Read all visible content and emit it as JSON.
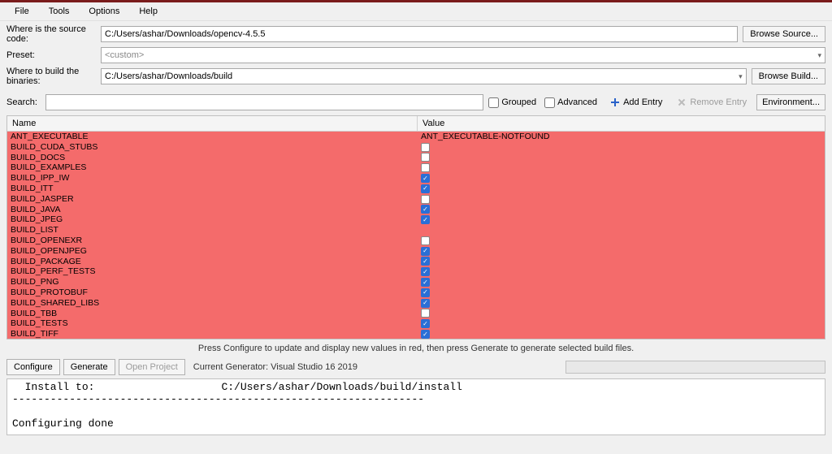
{
  "menu": {
    "file": "File",
    "tools": "Tools",
    "options": "Options",
    "help": "Help"
  },
  "labels": {
    "source": "Where is the source code:",
    "preset": "Preset:",
    "build": "Where to build the binaries:",
    "search": "Search:",
    "grouped": "Grouped",
    "advanced": "Advanced",
    "add_entry": "Add Entry",
    "remove_entry": "Remove Entry",
    "environment": "Environment...",
    "browse_source": "Browse Source...",
    "browse_build": "Browse Build...",
    "configure": "Configure",
    "generate": "Generate",
    "open_project": "Open Project",
    "current_generator": "Current Generator: Visual Studio 16 2019",
    "hint": "Press Configure to update and display new values in red, then press Generate to generate selected build files."
  },
  "fields": {
    "source_path": "C:/Users/ashar/Downloads/opencv-4.5.5",
    "preset_value": "<custom>",
    "build_path": "C:/Users/ashar/Downloads/build",
    "search_value": ""
  },
  "columns": {
    "name": "Name",
    "value": "Value"
  },
  "entries": [
    {
      "name": "ANT_EXECUTABLE",
      "type": "text",
      "value": "ANT_EXECUTABLE-NOTFOUND"
    },
    {
      "name": "BUILD_CUDA_STUBS",
      "type": "bool",
      "value": false
    },
    {
      "name": "BUILD_DOCS",
      "type": "bool",
      "value": false
    },
    {
      "name": "BUILD_EXAMPLES",
      "type": "bool",
      "value": false
    },
    {
      "name": "BUILD_IPP_IW",
      "type": "bool",
      "value": true
    },
    {
      "name": "BUILD_ITT",
      "type": "bool",
      "value": true
    },
    {
      "name": "BUILD_JASPER",
      "type": "bool",
      "value": false
    },
    {
      "name": "BUILD_JAVA",
      "type": "bool",
      "value": true
    },
    {
      "name": "BUILD_JPEG",
      "type": "bool",
      "value": true
    },
    {
      "name": "BUILD_LIST",
      "type": "text",
      "value": ""
    },
    {
      "name": "BUILD_OPENEXR",
      "type": "bool",
      "value": false
    },
    {
      "name": "BUILD_OPENJPEG",
      "type": "bool",
      "value": true
    },
    {
      "name": "BUILD_PACKAGE",
      "type": "bool",
      "value": true
    },
    {
      "name": "BUILD_PERF_TESTS",
      "type": "bool",
      "value": true
    },
    {
      "name": "BUILD_PNG",
      "type": "bool",
      "value": true
    },
    {
      "name": "BUILD_PROTOBUF",
      "type": "bool",
      "value": true
    },
    {
      "name": "BUILD_SHARED_LIBS",
      "type": "bool",
      "value": true
    },
    {
      "name": "BUILD_TBB",
      "type": "bool",
      "value": false
    },
    {
      "name": "BUILD_TESTS",
      "type": "bool",
      "value": true
    },
    {
      "name": "BUILD_TIFF",
      "type": "bool",
      "value": true
    }
  ],
  "output": {
    "line1": "  Install to:                    C:/Users/ashar/Downloads/build/install",
    "line2": "-----------------------------------------------------------------",
    "line3": "",
    "line4": "Configuring done"
  }
}
